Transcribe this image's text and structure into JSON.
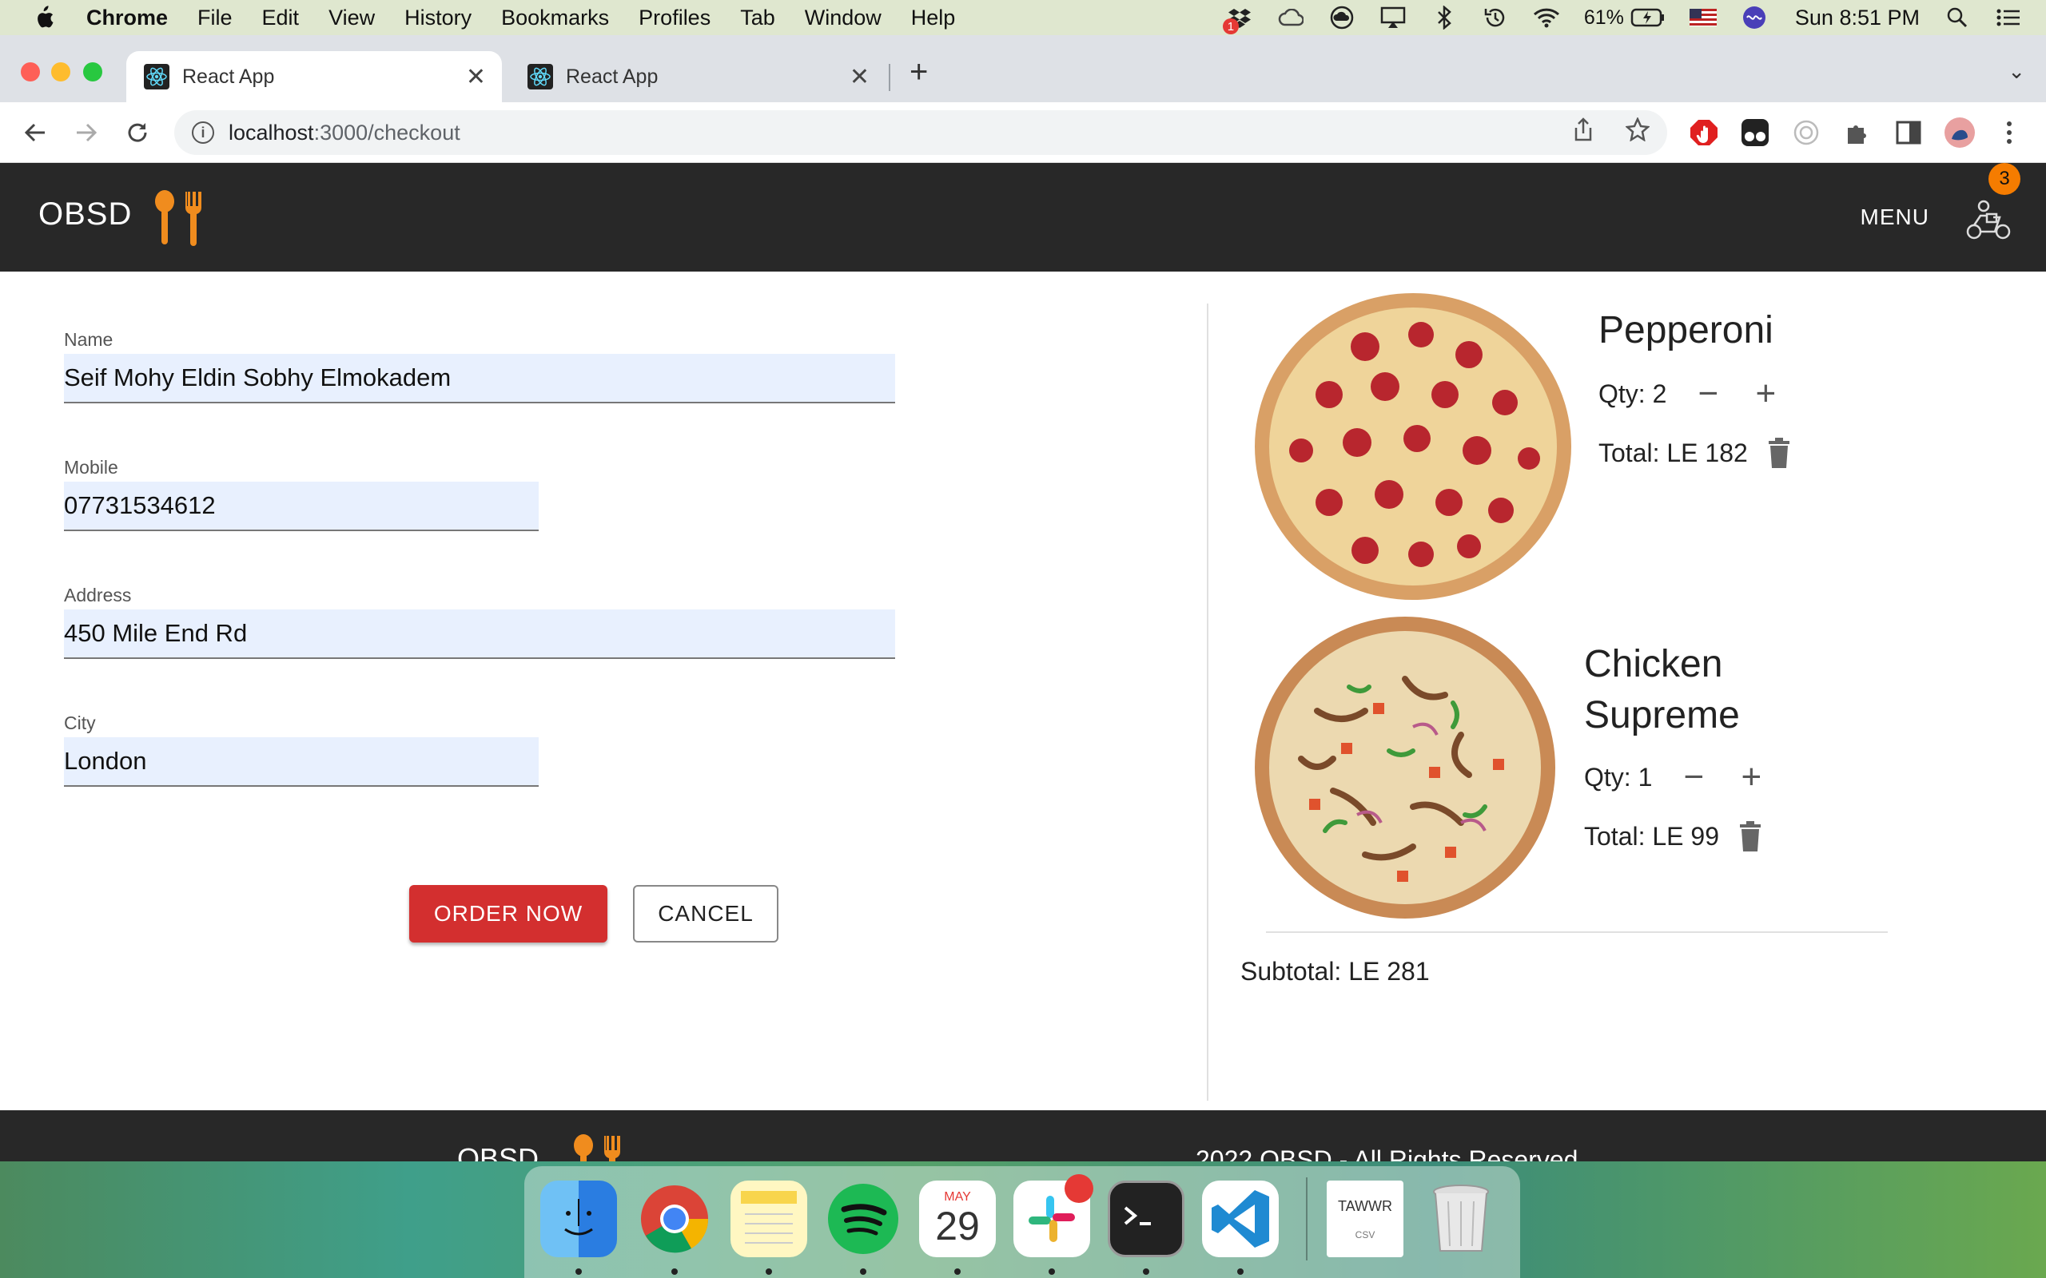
{
  "menubar": {
    "app_name": "Chrome",
    "items": [
      "File",
      "Edit",
      "View",
      "History",
      "Bookmarks",
      "Profiles",
      "Tab",
      "Window",
      "Help"
    ],
    "battery": "61%",
    "clock": "Sun 8:51 PM",
    "notification_badge": "1"
  },
  "browser": {
    "tabs": [
      {
        "title": "React App",
        "active": true
      },
      {
        "title": "React App",
        "active": false
      }
    ],
    "url_host": "localhost",
    "url_path": ":3000/checkout"
  },
  "app": {
    "brand": "OBSD",
    "menu_label": "MENU",
    "cart_count": "3",
    "accent_color": "#f57c00"
  },
  "form": {
    "name": {
      "label": "Name",
      "value": "Seif Mohy Eldin Sobhy Elmokadem"
    },
    "mobile": {
      "label": "Mobile",
      "value": "07731534612"
    },
    "address": {
      "label": "Address",
      "value": "450 Mile End Rd"
    },
    "city": {
      "label": "City",
      "value": "London"
    },
    "order_label": "ORDER NOW",
    "cancel_label": "CANCEL"
  },
  "cart": {
    "items": [
      {
        "name": "Pepperoni",
        "qty_text": "Qty: 2",
        "total_text": "Total: LE 182"
      },
      {
        "name": "Chicken Supreme",
        "qty_text": "Qty: 1",
        "total_text": "Total: LE 99"
      }
    ],
    "subtotal_text": "Subtotal: LE 281"
  },
  "footer": {
    "brand": "OBSD",
    "copyright": "2022 OBSD - All Rights Reserved"
  },
  "dock": {
    "calendar_month": "MAY",
    "calendar_day": "29",
    "file_label": "TAWWR",
    "file_ext": "CSV",
    "icons": [
      "finder-icon",
      "chrome-icon",
      "notes-icon",
      "spotify-icon",
      "calendar-icon",
      "slack-icon",
      "terminal-icon",
      "vscode-icon",
      "file-icon",
      "trash-icon"
    ]
  }
}
